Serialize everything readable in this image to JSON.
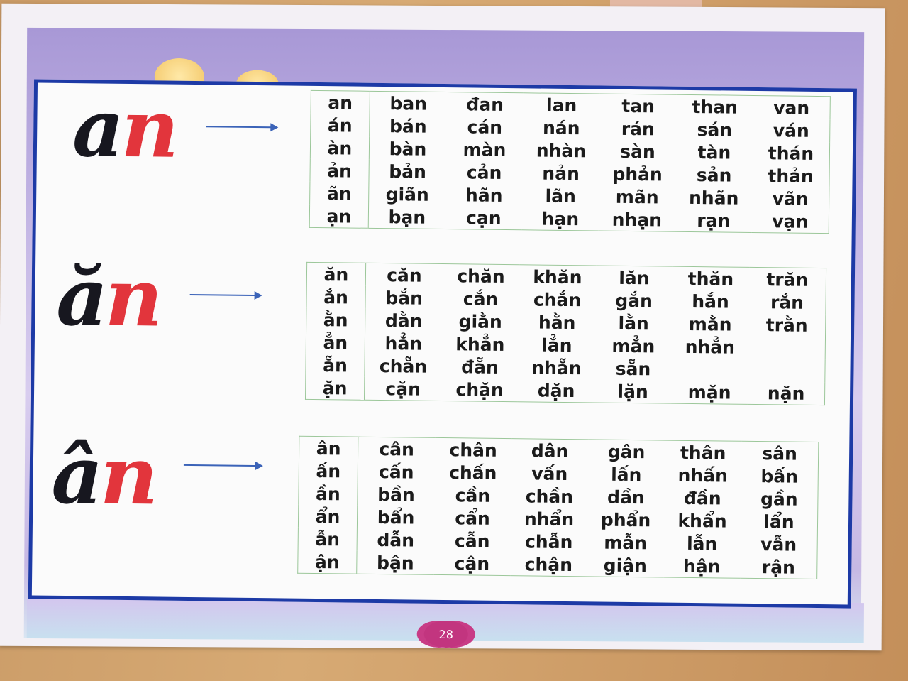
{
  "page_number": "28",
  "sections": [
    {
      "vowel": "a",
      "final": "n",
      "rows": [
        [
          "an",
          "ban",
          "đan",
          "lan",
          "tan",
          "than",
          "van"
        ],
        [
          "án",
          "bán",
          "cán",
          "nán",
          "rán",
          "sán",
          "ván"
        ],
        [
          "àn",
          "bàn",
          "màn",
          "nhàn",
          "sàn",
          "tàn",
          "thán"
        ],
        [
          "ản",
          "bản",
          "cản",
          "nản",
          "phản",
          "sản",
          "thản"
        ],
        [
          "ãn",
          "giãn",
          "hãn",
          "lãn",
          "mãn",
          "nhãn",
          "vãn"
        ],
        [
          "ạn",
          "bạn",
          "cạn",
          "hạn",
          "nhạn",
          "rạn",
          "vạn"
        ]
      ]
    },
    {
      "vowel": "ă",
      "final": "n",
      "rows": [
        [
          "ăn",
          "căn",
          "chăn",
          "khăn",
          "lăn",
          "thăn",
          "trăn"
        ],
        [
          "ắn",
          "bắn",
          "cắn",
          "chắn",
          "gắn",
          "hắn",
          "rắn"
        ],
        [
          "ằn",
          "dằn",
          "giằn",
          "hằn",
          "lằn",
          "mằn",
          "trằn"
        ],
        [
          "ẳn",
          "hẳn",
          "khẳn",
          "lẳn",
          "mẳn",
          "nhẳn",
          ""
        ],
        [
          "ẵn",
          "chẵn",
          "đẵn",
          "nhẵn",
          "sẵn",
          "",
          ""
        ],
        [
          "ặn",
          "cặn",
          "chặn",
          "dặn",
          "lặn",
          "mặn",
          "nặn"
        ]
      ]
    },
    {
      "vowel": "â",
      "final": "n",
      "rows": [
        [
          "ân",
          "cân",
          "chân",
          "dân",
          "gân",
          "thân",
          "sân"
        ],
        [
          "ấn",
          "cấn",
          "chấn",
          "vấn",
          "lấn",
          "nhấn",
          "bấn"
        ],
        [
          "ần",
          "bần",
          "cần",
          "chần",
          "dần",
          "đần",
          "gần"
        ],
        [
          "ẩn",
          "bẩn",
          "cẩn",
          "nhẩn",
          "phẩn",
          "khẩn",
          "lẩn"
        ],
        [
          "ẫn",
          "dẫn",
          "cẫn",
          "chẫn",
          "mẫn",
          "lẫn",
          "vẫn"
        ],
        [
          "ận",
          "bận",
          "cận",
          "chận",
          "giận",
          "hận",
          "rận"
        ]
      ]
    }
  ],
  "colors": {
    "frame": "#1d3aa6",
    "vowel": "#17171f",
    "final": "#e2353c",
    "arrow": "#3b63b8"
  }
}
